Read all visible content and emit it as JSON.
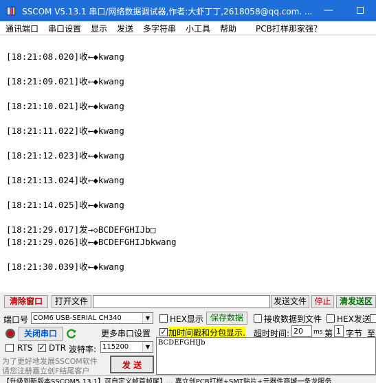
{
  "window": {
    "title": "SSCOM V5.13.1 串口/网络数据调试器,作者:大虾丁丁,2618058@qq.com. ...",
    "minimize": "—",
    "accent_color": "#1e6fd9"
  },
  "menu": [
    "通讯端口",
    "串口设置",
    "显示",
    "发送",
    "多字符串",
    "小工具",
    "帮助",
    "PCB打样那家强？"
  ],
  "receive_lines": [
    "[18:21:08.020]收←◆kwang",
    "[18:21:09.021]收←◆kwang",
    "[18:21:10.021]收←◆kwang",
    "[18:21:11.022]收←◆kwang",
    "[18:21:12.023]收←◆kwang",
    "[18:21:13.024]收←◆kwang",
    "[18:21:14.025]收←◆kwang",
    "[18:21:29.017]发→◇BCDEFGHIJb□",
    "[18:21:29.026]收←◆BCDEFGHIJbkwang",
    "[18:21:30.039]收←◆kwang"
  ],
  "toolbar": {
    "clear_window": "清除窗口",
    "open_file": "打开文件",
    "file_path": "",
    "send_file": "发送文件",
    "stop": "停止",
    "clear_send": "清发送区"
  },
  "port": {
    "label": "端口号",
    "value": "COM6 USB-SERIAL CH340",
    "close_port": "关闭串口",
    "more_settings": "更多串口设置",
    "rts_label": "RTS",
    "dtr_label": "DTR",
    "rts_checked": false,
    "dtr_checked": true,
    "baud_label": "波特率:",
    "baud_value": "115200"
  },
  "options": {
    "hex_display": "HEX显示",
    "save_data": "保存数据",
    "receive_to_file": "接收数据到文件",
    "hex_send": "HEX发送",
    "timestamp": "加时间戳和分包显示.",
    "timeout_label": "超时时间:",
    "timeout_value": "20",
    "timeout_unit": "ms",
    "byte_prefix": "第",
    "byte_value": "1",
    "byte_unit": "字节",
    "to_label": "至"
  },
  "promo": {
    "line1": "为了更好地发展SSCOM软件",
    "line2": "请您注册嘉立创F结尾客户"
  },
  "send": {
    "button": "发 送",
    "text": "BCDEFGHIJb"
  },
  "status": {
    "text": "【升级到新版本SSCOM5.13.1】可自定义帧首帧尾】... 嘉立创PCB打样+SMT贴片+元器件商城一条龙服务"
  }
}
